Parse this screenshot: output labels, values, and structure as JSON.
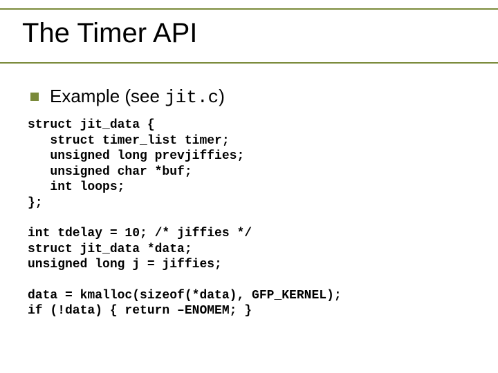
{
  "title": "The Timer API",
  "bullet": {
    "prefix": "Example (see ",
    "code": "jit.c",
    "suffix": ")"
  },
  "code_block_1": "struct jit_data {\n   struct timer_list timer;\n   unsigned long prevjiffies;\n   unsigned char *buf;\n   int loops;\n};",
  "code_block_2": "int tdelay = 10; /* jiffies */\nstruct jit_data *data;\nunsigned long j = jiffies;",
  "code_block_3": "data = kmalloc(sizeof(*data), GFP_KERNEL);\nif (!data) { return –ENOMEM; }"
}
